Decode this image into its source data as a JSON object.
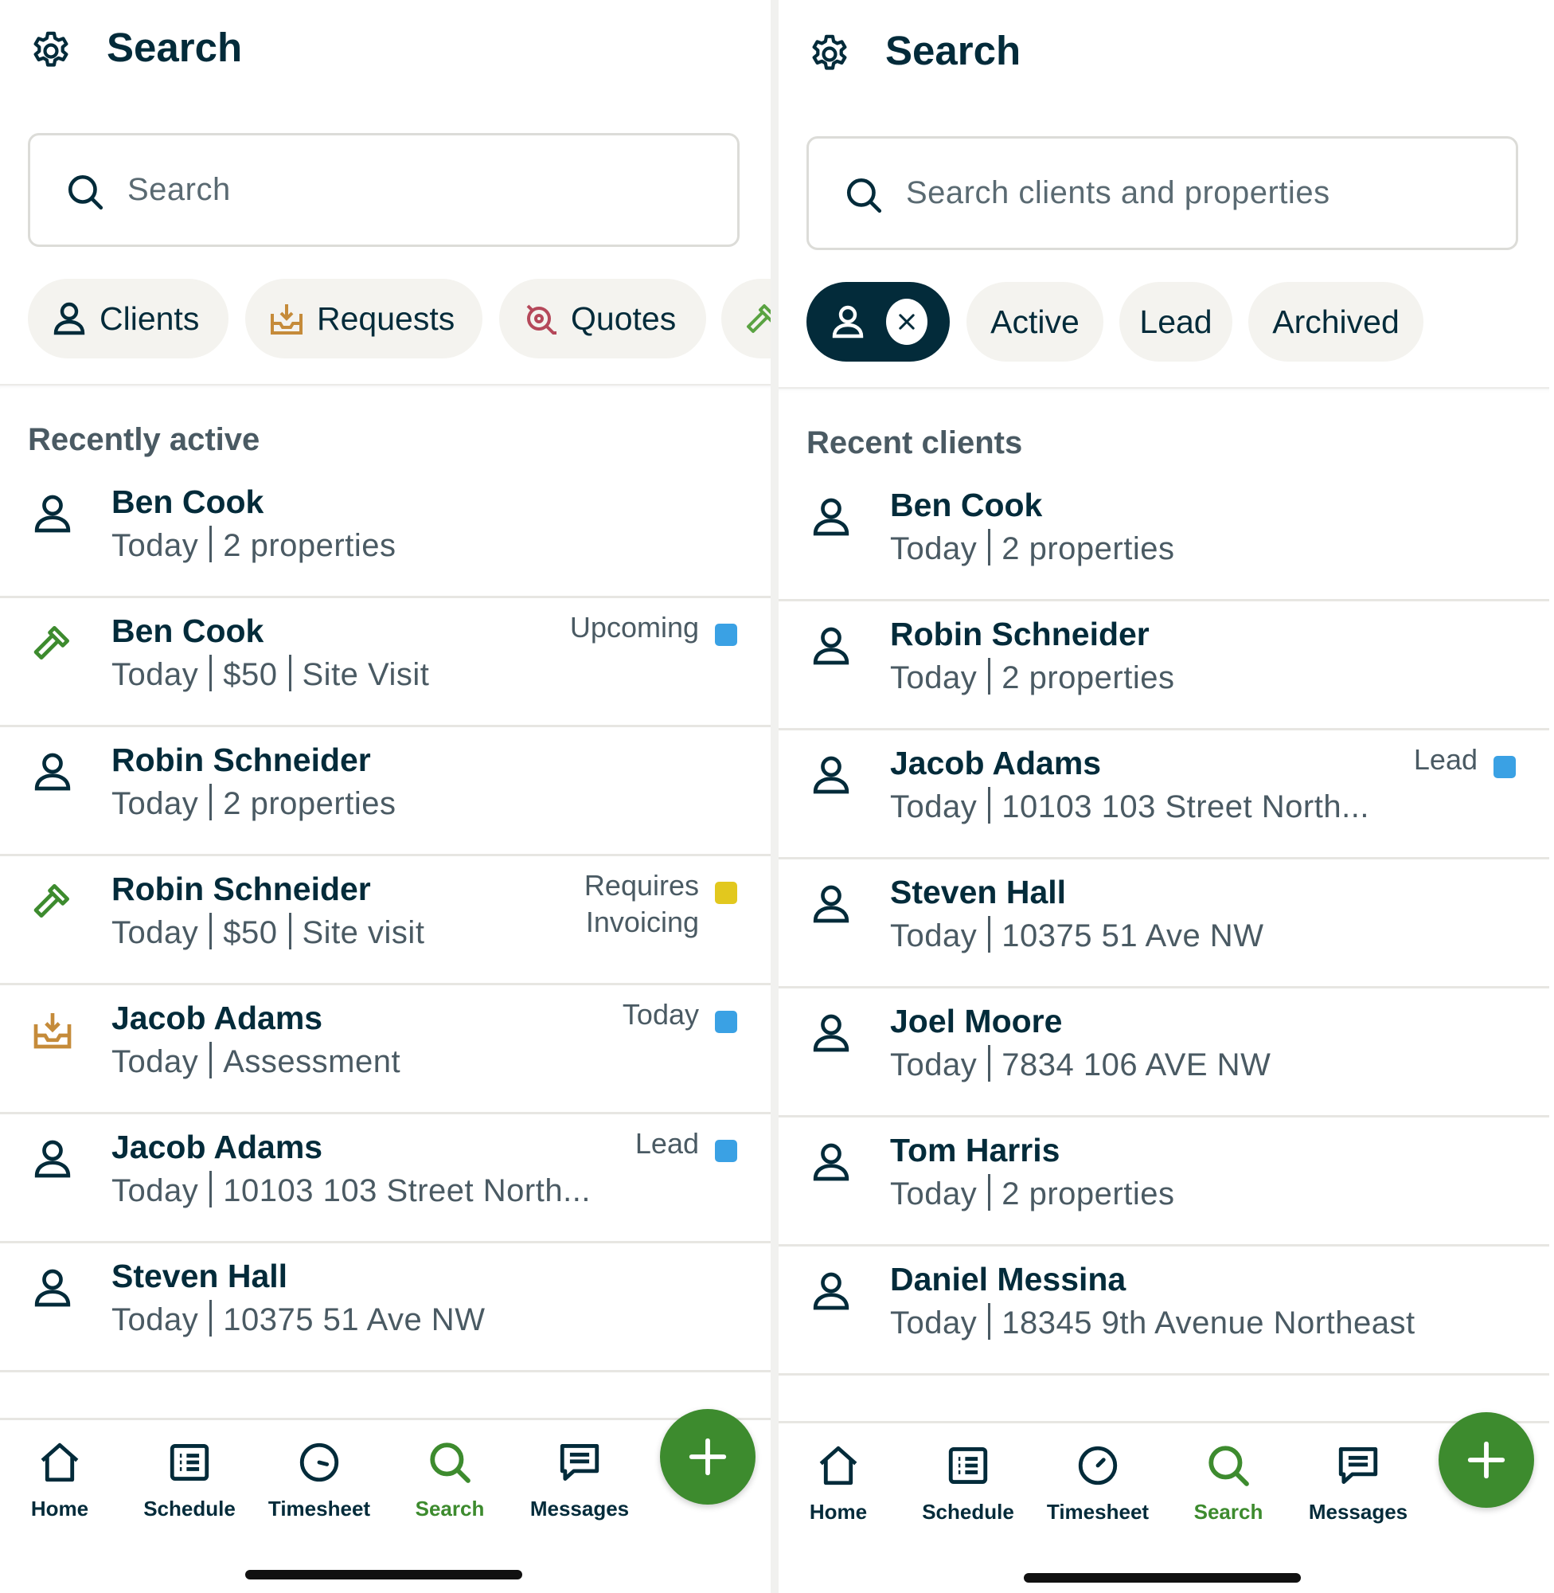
{
  "colors": {
    "navy": "#032b3a",
    "green": "#3d8b2e",
    "blue_dot": "#3aa1e4",
    "yellow_dot": "#e2c81e",
    "chip_bg": "#f4f3ef"
  },
  "left": {
    "title": "Search",
    "search_placeholder": "Search",
    "chips": [
      {
        "icon": "person-icon",
        "label": "Clients"
      },
      {
        "icon": "request-inbox-icon",
        "label": "Requests"
      },
      {
        "icon": "quote-icon",
        "label": "Quotes"
      }
    ],
    "section_title": "Recently active",
    "rows": [
      {
        "icon": "person-icon",
        "name": "Ben Cook",
        "date": "Today",
        "detail": "2 properties",
        "extra": "",
        "status": "",
        "status2": "",
        "dot": ""
      },
      {
        "icon": "hammer-icon",
        "name": "Ben Cook",
        "date": "Today",
        "detail": "$50",
        "extra": "Site Visit",
        "status": "Upcoming",
        "status2": "",
        "dot": "#3aa1e4"
      },
      {
        "icon": "person-icon",
        "name": "Robin Schneider",
        "date": "Today",
        "detail": "2 properties",
        "extra": "",
        "status": "",
        "status2": "",
        "dot": ""
      },
      {
        "icon": "hammer-icon",
        "name": "Robin Schneider",
        "date": "Today",
        "detail": "$50",
        "extra": "Site visit",
        "status": "Requires",
        "status2": "Invoicing",
        "dot": "#e2c81e"
      },
      {
        "icon": "request-inbox-icon",
        "name": "Jacob Adams",
        "date": "Today",
        "detail": "Assessment",
        "extra": "",
        "status": "Today",
        "status2": "",
        "dot": "#3aa1e4"
      },
      {
        "icon": "person-icon",
        "name": "Jacob Adams",
        "date": "Today",
        "detail": "10103 103 Street North...",
        "extra": "",
        "status": "Lead",
        "status2": "",
        "dot": "#3aa1e4"
      },
      {
        "icon": "person-icon",
        "name": "Steven Hall",
        "date": "Today",
        "detail": "10375 51 Ave NW",
        "extra": "",
        "status": "",
        "status2": "",
        "dot": ""
      }
    ]
  },
  "right": {
    "title": "Search",
    "search_placeholder": "Search clients and properties",
    "chips": [
      {
        "label": "Active"
      },
      {
        "label": "Lead"
      },
      {
        "label": "Archived"
      }
    ],
    "section_title": "Recent clients",
    "rows": [
      {
        "icon": "person-icon",
        "name": "Ben Cook",
        "date": "Today",
        "detail": "2 properties",
        "status": "",
        "dot": ""
      },
      {
        "icon": "person-icon",
        "name": "Robin Schneider",
        "date": "Today",
        "detail": "2 properties",
        "status": "",
        "dot": ""
      },
      {
        "icon": "person-icon",
        "name": "Jacob Adams",
        "date": "Today",
        "detail": "10103 103 Street North...",
        "status": "Lead",
        "dot": "#3aa1e4"
      },
      {
        "icon": "person-icon",
        "name": "Steven Hall",
        "date": "Today",
        "detail": "10375 51 Ave NW",
        "status": "",
        "dot": ""
      },
      {
        "icon": "person-icon",
        "name": "Joel Moore",
        "date": "Today",
        "detail": "7834 106 AVE NW",
        "status": "",
        "dot": ""
      },
      {
        "icon": "person-icon",
        "name": "Tom Harris",
        "date": "Today",
        "detail": "2 properties",
        "status": "",
        "dot": ""
      },
      {
        "icon": "person-icon",
        "name": "Daniel Messina",
        "date": "Today",
        "detail": "18345 9th Avenue Northeast",
        "status": "",
        "dot": ""
      }
    ]
  },
  "nav": {
    "home": "Home",
    "schedule": "Schedule",
    "timesheet": "Timesheet",
    "search": "Search",
    "messages": "Messages"
  }
}
